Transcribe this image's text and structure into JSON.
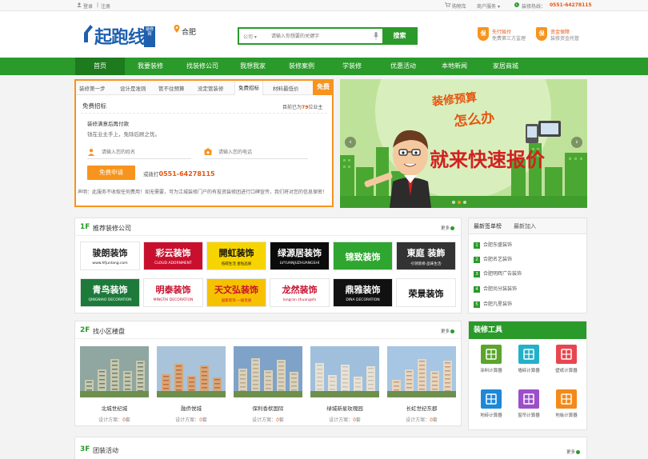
{
  "topbar": {
    "login": "登录",
    "register": "注册",
    "cart": "购物车",
    "services": "商户服务",
    "hotline_label": "装修热线：",
    "hotline": "0551-64278115"
  },
  "header": {
    "logo_text": "起跑线",
    "logo_badge": "装修网",
    "city": "合肥",
    "search_scope": "公司",
    "search_placeholder": "请输入你想要的关键字",
    "search_button": "搜索",
    "promises": [
      {
        "icon": "保",
        "line1": "先行赔付",
        "line2": "免费第三方监理"
      },
      {
        "icon": "保",
        "line1": "资金保障",
        "line2": "装修资金托管"
      }
    ]
  },
  "nav": [
    "首页",
    "我要装修",
    "找装修公司",
    "我想我家",
    "装修案例",
    "学装修",
    "优惠活动",
    "本地新闻",
    "家居商城"
  ],
  "consult": {
    "tabs": [
      "装修第一步",
      "设计是准则",
      "管不住预算",
      "没定管装修",
      "免费招标",
      "材料最低价"
    ],
    "ribbon": "免费",
    "subtitle": "免费招标",
    "count_prefix": "目前已为",
    "count": "79",
    "count_suffix": "位业主",
    "tip1": "装修满意后再付款",
    "tip2": "钱在业主手上，免除后顾之忧。",
    "name_placeholder": "请输入您的姓名",
    "phone_placeholder": "请输入您的电话",
    "apply_button": "免费申请",
    "or_call": "或拨打",
    "phone": "0551-64278115",
    "note": "声明：此服务不收取任何费用！如无需要，可为江城装修门户的有投资装修团进行口碑宣传，我们将对您的信息保密！"
  },
  "banner": {
    "line1": "装修预算",
    "line2": "怎么办",
    "line3": "就来快速报价"
  },
  "floor1": {
    "num": "1F",
    "title": "推荐装修公司",
    "more": "更多",
    "companies": [
      {
        "name": "骏朗装饰",
        "sub": "www.hfjunlang.com",
        "bg": "#ffffff",
        "fg": "#222222"
      },
      {
        "name": "彩云装饰",
        "sub": "CLOUD ADORNMENT",
        "bg": "#c8102e",
        "fg": "#ffffff"
      },
      {
        "name": "開虹装饰",
        "sub": "低碳生活 金钻品质",
        "bg": "#f6d400",
        "fg": "#111111"
      },
      {
        "name": "绿源居装饰",
        "sub": "LVYUANJUZHUANGSHI",
        "bg": "#0b0b0b",
        "fg": "#ffffff"
      },
      {
        "name": "锦致装饰",
        "sub": "",
        "bg": "#2fa62f",
        "fg": "#ffffff"
      },
      {
        "name": "東庭 装飾",
        "sub": "·引领装修·品味生活·",
        "bg": "#333333",
        "fg": "#ffffff"
      },
      {
        "name": "青鸟装饰",
        "sub": "QINGNIAO DECORATION",
        "bg": "#1d7a3a",
        "fg": "#ffffff"
      },
      {
        "name": "明泰装饰",
        "sub": "MINGTAI DECORATION",
        "bg": "#ffffff",
        "fg": "#c8102e"
      },
      {
        "name": "天文弘装饰",
        "sub": "国家装饰 一级资质",
        "bg": "#f6c200",
        "fg": "#c8102e"
      },
      {
        "name": "龙然装饰",
        "sub": "longran zhuangshi",
        "bg": "#ffffff",
        "fg": "#c8102e"
      },
      {
        "name": "鼎雅装饰",
        "sub": "DINA DECORATION",
        "bg": "#111111",
        "fg": "#ffffff"
      },
      {
        "name": "荣景装饰",
        "sub": "",
        "bg": "#ffffff",
        "fg": "#111111"
      }
    ]
  },
  "news": {
    "tabs": [
      "最新签单榜",
      "最新加入"
    ],
    "items": [
      "合肥东盛装饰",
      "合肥名艺装饰",
      "合肥明辉广告装饰",
      "合肥尚分装装饰",
      "合肥凡星装饰"
    ]
  },
  "floor2": {
    "num": "2F",
    "title": "找小区楼盘",
    "more": "更多",
    "plans_prefix": "设计方案：",
    "plans_suffix": "套",
    "houses": [
      {
        "name": "北城世纪城",
        "plans": "0"
      },
      {
        "name": "融侨悦城",
        "plans": "0"
      },
      {
        "name": "保利香槟国际",
        "plans": "0"
      },
      {
        "name": "绿城新星玫瑰园",
        "plans": "0"
      },
      {
        "name": "长虹世纪东郡",
        "plans": "0"
      }
    ]
  },
  "tools": {
    "title": "装修工具",
    "items": [
      {
        "label": "涂料计算器",
        "color": "#5aa52a"
      },
      {
        "label": "墙砖计算器",
        "color": "#24b0c9"
      },
      {
        "label": "壁纸计算器",
        "color": "#e8464e"
      },
      {
        "label": "地砖计算器",
        "color": "#1e88d8"
      },
      {
        "label": "窗帘计算器",
        "color": "#9b4fc8"
      },
      {
        "label": "地板计算器",
        "color": "#f38a1a"
      }
    ]
  },
  "floor3": {
    "num": "3F",
    "title": "团装活动",
    "more": "更多"
  }
}
